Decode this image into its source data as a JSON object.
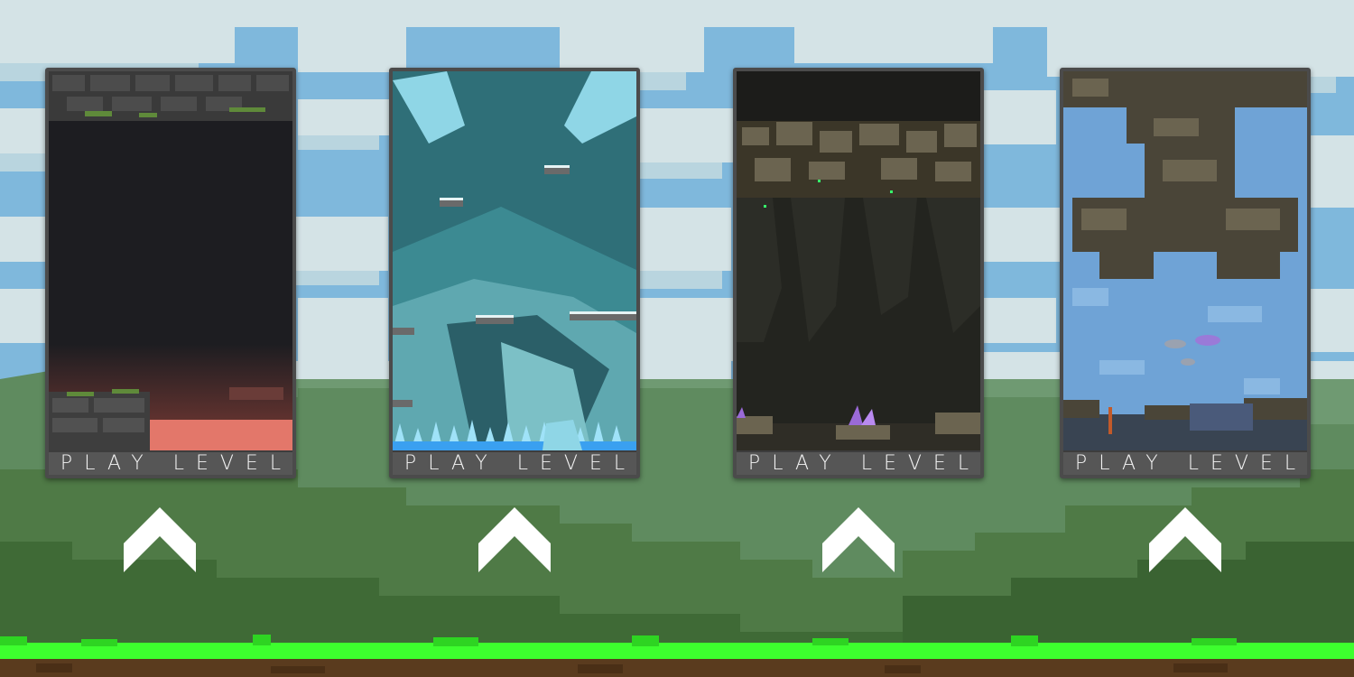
{
  "colors": {
    "sky": "#7fb8dc",
    "cloud": "#d6e4e6",
    "hill_dark": "#3f6a36",
    "hill_light": "#6c9172",
    "grass": "#3dff2e",
    "dirt": "#5a3b1e",
    "card_frame": "#4b4b4b",
    "play_bar": "#565656",
    "play_text": "#f4f4f4",
    "chevron": "#ffffff"
  },
  "levels": [
    {
      "theme": "dark-stone-cave-with-lava",
      "play_label": "PLAY LEVEL",
      "arrow_icon": "chevron-up-icon"
    },
    {
      "theme": "ice-crystal-cavern",
      "play_label": "PLAY LEVEL",
      "arrow_icon": "chevron-up-icon"
    },
    {
      "theme": "mossy-rock-cave-with-purple-crystals",
      "play_label": "PLAY LEVEL",
      "arrow_icon": "chevron-up-icon"
    },
    {
      "theme": "underwater-reef-with-fish",
      "play_label": "PLAY LEVEL",
      "arrow_icon": "chevron-up-icon"
    }
  ]
}
